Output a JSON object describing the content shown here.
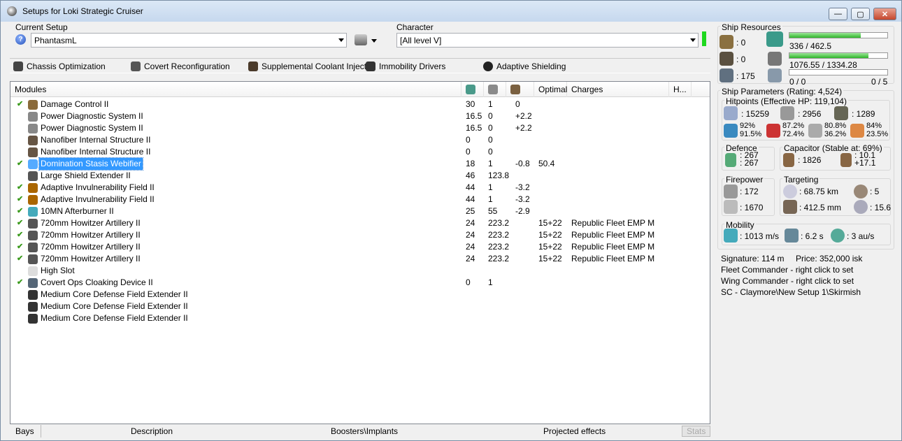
{
  "window": {
    "title": "Setups for Loki Strategic Cruiser",
    "min": "—",
    "max": "▢",
    "close": "✕"
  },
  "current_setup": {
    "label": "Current Setup",
    "value": "PhantasmL"
  },
  "character": {
    "label": "Character",
    "value": "[All level V]"
  },
  "implants": [
    "Chassis Optimization",
    "Covert Reconfiguration",
    "Supplemental Coolant Injector",
    "Immobility Drivers",
    "Adaptive Shielding"
  ],
  "columns": {
    "modules": "Modules",
    "optimal": "Optimal",
    "charges": "Charges",
    "h": "H..."
  },
  "modules": [
    {
      "name": "Damage Control II",
      "c": "✔",
      "v1": "30",
      "v2": "1",
      "v3": "0",
      "opt": "",
      "chg": ""
    },
    {
      "name": "Power Diagnostic System II",
      "c": "",
      "v1": "16.5",
      "v2": "0",
      "v3": "+2.2",
      "opt": "",
      "chg": ""
    },
    {
      "name": "Power Diagnostic System II",
      "c": "",
      "v1": "16.5",
      "v2": "0",
      "v3": "+2.2",
      "opt": "",
      "chg": ""
    },
    {
      "name": "Nanofiber Internal Structure II",
      "c": "",
      "v1": "0",
      "v2": "0",
      "v3": "",
      "opt": "",
      "chg": ""
    },
    {
      "name": "Nanofiber Internal Structure II",
      "c": "",
      "v1": "0",
      "v2": "0",
      "v3": "",
      "opt": "",
      "chg": ""
    },
    {
      "name": "Domination Stasis Webifier",
      "c": "✔",
      "v1": "18",
      "v2": "1",
      "v3": "-0.8",
      "opt": "50.4",
      "chg": "",
      "selected": true
    },
    {
      "name": "Large Shield Extender II",
      "c": "",
      "v1": "46",
      "v2": "123.8",
      "v3": "",
      "opt": "",
      "chg": ""
    },
    {
      "name": "Adaptive Invulnerability Field II",
      "c": "✔",
      "v1": "44",
      "v2": "1",
      "v3": "-3.2",
      "opt": "",
      "chg": ""
    },
    {
      "name": "Adaptive Invulnerability Field II",
      "c": "✔",
      "v1": "44",
      "v2": "1",
      "v3": "-3.2",
      "opt": "",
      "chg": ""
    },
    {
      "name": "10MN Afterburner II",
      "c": "✔",
      "v1": "25",
      "v2": "55",
      "v3": "-2.9",
      "opt": "",
      "chg": ""
    },
    {
      "name": "720mm Howitzer Artillery II",
      "c": "✔",
      "v1": "24",
      "v2": "223.2",
      "v3": "",
      "opt": "15+22",
      "chg": "Republic Fleet EMP M"
    },
    {
      "name": "720mm Howitzer Artillery II",
      "c": "✔",
      "v1": "24",
      "v2": "223.2",
      "v3": "",
      "opt": "15+22",
      "chg": "Republic Fleet EMP M"
    },
    {
      "name": "720mm Howitzer Artillery II",
      "c": "✔",
      "v1": "24",
      "v2": "223.2",
      "v3": "",
      "opt": "15+22",
      "chg": "Republic Fleet EMP M"
    },
    {
      "name": "720mm Howitzer Artillery II",
      "c": "✔",
      "v1": "24",
      "v2": "223.2",
      "v3": "",
      "opt": "15+22",
      "chg": "Republic Fleet EMP M"
    },
    {
      "name": "High Slot",
      "c": "",
      "v1": "",
      "v2": "",
      "v3": "",
      "opt": "",
      "chg": ""
    },
    {
      "name": "Covert Ops Cloaking Device II",
      "c": "✔",
      "v1": "0",
      "v2": "1",
      "v3": "",
      "opt": "",
      "chg": ""
    },
    {
      "name": "Medium Core Defense Field Extender II",
      "c": "",
      "v1": "",
      "v2": "",
      "v3": "",
      "opt": "",
      "chg": ""
    },
    {
      "name": "Medium Core Defense Field Extender II",
      "c": "",
      "v1": "",
      "v2": "",
      "v3": "",
      "opt": "",
      "chg": ""
    },
    {
      "name": "Medium Core Defense Field Extender II",
      "c": "",
      "v1": "",
      "v2": "",
      "v3": "",
      "opt": "",
      "chg": ""
    }
  ],
  "status_tabs": [
    "Bays",
    "Description",
    "Boosters\\Implants",
    "Projected effects",
    "Stats"
  ],
  "resources": {
    "title": "Ship Resources",
    "turrets": ": 0",
    "launchers": ": 0",
    "calibration": ": 175",
    "cpu": "336 / 462.5",
    "cpu_fill": 0.73,
    "pg": "1076.55 / 1334.28",
    "pg_fill": 0.81,
    "drone_bw": "0 / 0",
    "drone_count": "0 / 5",
    "drone_fill": 0
  },
  "params": {
    "title": "Ship Parameters (Rating: 4,524)",
    "hp_title": "Hitpoints (Effective HP: 119,104)",
    "shield": ": 15259",
    "armor": ": 2956",
    "hull": ": 1289",
    "res": [
      [
        "92%",
        "91.5%"
      ],
      [
        "87.2%",
        "72.4%"
      ],
      [
        "80.8%",
        "36.2%"
      ],
      [
        "84%",
        "23.5%"
      ]
    ],
    "defence_title": "Defence",
    "def1": ": 267",
    "def2": ": 267",
    "cap_title": "Capacitor (Stable at: 69%)",
    "cap": ": 1826",
    "cap_a": ": 10.1",
    "cap_b": "+17.1",
    "fp_title": "Firepower",
    "dps": ": 172",
    "volley": ": 1670",
    "tgt_title": "Targeting",
    "range": ": 68.75 km",
    "targets": ": 5",
    "scan": ": 412.5 mm",
    "sensor": ": 15.6",
    "mob_title": "Mobility",
    "speed": ": 1013 m/s",
    "align": ": 6.2 s",
    "warp": ": 3 au/s"
  },
  "info": {
    "signature": "Signature: 114 m",
    "price": "Price: 352,000 isk",
    "fleet": "Fleet Commander - right click to set",
    "wing": "Wing Commander - right click to set",
    "path": "SC - Claymore\\New Setup 1\\Skirmish"
  }
}
